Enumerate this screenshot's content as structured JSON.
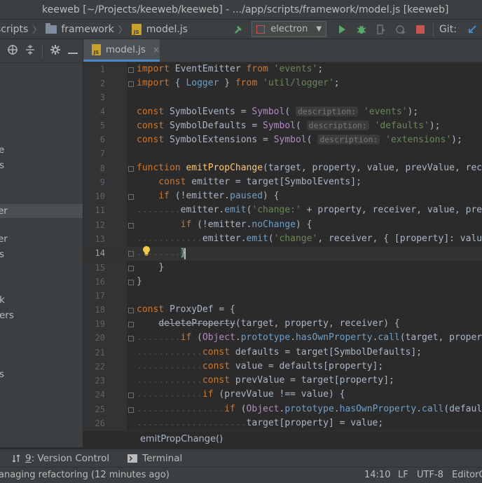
{
  "window": {
    "title": "keeweb [~/Projects/keeweb/keeweb] - .../app/scripts/framework/model.js [keeweb]"
  },
  "navbar": {
    "crumbs": [
      "scripts",
      "framework",
      "model.js"
    ],
    "run_config": "electron",
    "vcs_label": "Git:"
  },
  "sidebar": {
    "toolbar_icons": [
      "target-icon",
      "collapse-icon",
      "gear-icon",
      "minimize-icon"
    ],
    "visible_fragments": [
      "e",
      "s",
      "er",
      "er",
      "s",
      "k",
      "ers",
      "s"
    ]
  },
  "tab": {
    "label": "model.js",
    "close": "×"
  },
  "editor": {
    "current_line": 14,
    "line_numbers": [
      "1",
      "2",
      "3",
      "4",
      "5",
      "6",
      "7",
      "8",
      "9",
      "10",
      "11",
      "12",
      "13",
      "14",
      "15",
      "16",
      "17",
      "18",
      "19",
      "20",
      "21",
      "22",
      "23",
      "24",
      "25",
      "26"
    ],
    "param_hint": "description:",
    "code": {
      "l1": {
        "kw": "import",
        "a": " EventEmitter ",
        "kw2": "from",
        "str": "'events'",
        "end": ";"
      },
      "l2": {
        "kw": "import",
        "a": " { ",
        "cls": "Logger",
        "b": " } ",
        "kw2": "from",
        "str": "'util/logger'",
        "end": ";"
      },
      "l4": {
        "kw": "const",
        "a": " SymbolEvents = ",
        "fn": "Symbol",
        "b": "(",
        "str": "'events'",
        "end": ");"
      },
      "l5": {
        "kw": "const",
        "a": " SymbolDefaults = ",
        "fn": "Symbol",
        "b": "(",
        "str": "'defaults'",
        "end": ");"
      },
      "l6": {
        "kw": "const",
        "a": " SymbolExtensions = ",
        "fn": "Symbol",
        "b": "(",
        "str": "'extensions'",
        "end": ");"
      },
      "l8": {
        "kw": "function",
        "fn": " emitPropChange",
        "a": "(target, property, value, prevValue, rec"
      },
      "l9": {
        "kw": "const",
        "a": " emitter = target[SymbolEvents];"
      },
      "l10": {
        "kw": "if",
        "a": " (!emitter.",
        "prop": "paused",
        "b": ") {"
      },
      "l11": {
        "a": "emitter.",
        "meth": "emit",
        "b": "(",
        "str": "'change:'",
        "c": " + property, receiver, value, pre"
      },
      "l12": {
        "kw": "if",
        "a": " (!emitter.",
        "prop": "noChange",
        "b": ") {"
      },
      "l13": {
        "a": "emitter.",
        "meth": "emit",
        "b": "(",
        "str": "'change'",
        "c": ", receiver, { [property]: valu"
      },
      "l14": {
        "a": "}"
      },
      "l15": {
        "a": "}"
      },
      "l16": {
        "a": "}"
      },
      "l18": {
        "kw": "const",
        "a": " ProxyDef = {"
      },
      "l19": {
        "fn": "deleteProperty",
        "a": "(target, property, receiver) {"
      },
      "l20": {
        "kw": "if",
        "a": " (",
        "cls": "Object",
        "b": ".",
        "prop": "prototype",
        "c": ".",
        "meth": "hasOwnProperty",
        "d": ".",
        "meth2": "call",
        "e": "(target, proper"
      },
      "l21": {
        "kw": "const",
        "a": " defaults = target[SymbolDefaults];"
      },
      "l22": {
        "kw": "const",
        "a": " value = defaults[property];"
      },
      "l23": {
        "kw": "const",
        "a": " prevValue = target[property];"
      },
      "l24": {
        "kw": "if",
        "a": " (prevValue !== value) {"
      },
      "l25": {
        "kw": "if",
        "a": " (",
        "cls": "Object",
        "b": ".",
        "prop": "prototype",
        "c": ".",
        "meth": "hasOwnProperty",
        "d": ".",
        "meth2": "call",
        "e": "(defaul"
      },
      "l26": {
        "a": "target[property] = value;"
      }
    }
  },
  "breadcrumb": {
    "function": "emitPropChange()"
  },
  "toolwindows": {
    "version_control_num": "9",
    "version_control": ": Version Control",
    "terminal": "Terminal"
  },
  "status": {
    "message": "anaging refactoring (12 minutes ago)",
    "position": "14:10",
    "line_sep": "LF",
    "encoding": "UTF-8",
    "editorconfig": "EditorC"
  },
  "colors": {
    "accent": "#4a88c7",
    "keyword": "#cc7832",
    "string": "#6a8759",
    "function": "#ffc66d",
    "background": "#2b2b2b"
  }
}
